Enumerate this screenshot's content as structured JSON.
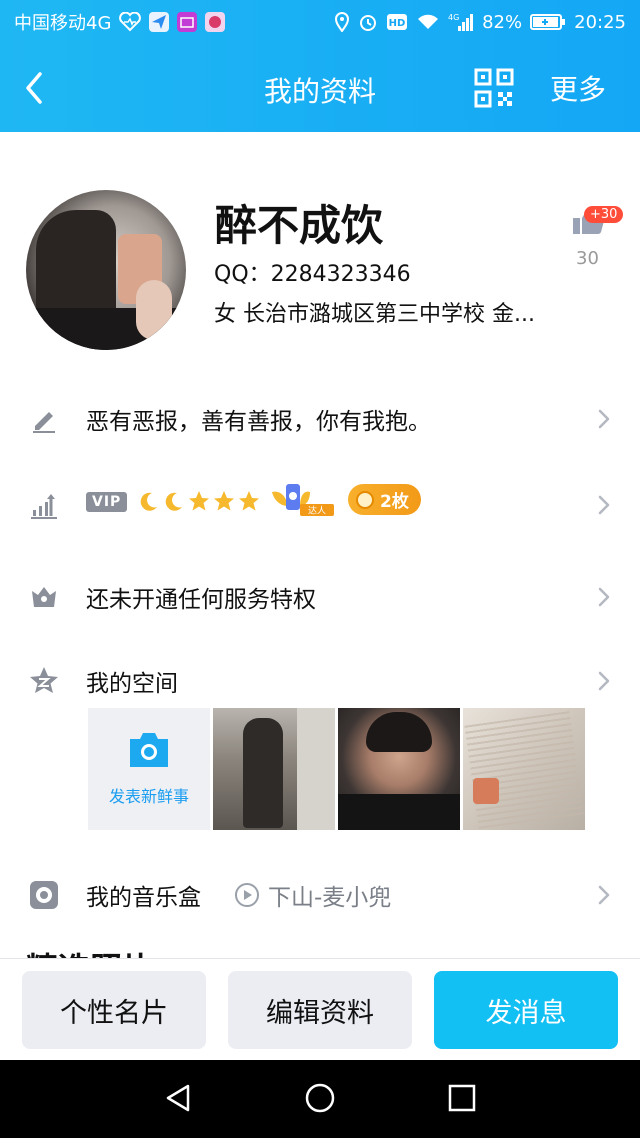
{
  "status_bar": {
    "carrier": "中国移动4G",
    "battery": "82%",
    "time": "20:25",
    "icons": [
      "heart-rate-icon",
      "send-app-icon",
      "mail-app-icon",
      "game-app-icon",
      "location-icon",
      "alarm-icon",
      "hd-icon",
      "wifi-icon",
      "signal-icon",
      "battery-icon"
    ]
  },
  "nav": {
    "title": "我的资料",
    "more": "更多"
  },
  "profile": {
    "name": "醉不成饮",
    "qq": "QQ：2284323346",
    "info": "女  长治市潞城区第三中学校  金...",
    "like_badge": "+30",
    "like_count": "30"
  },
  "rows": {
    "signature": "恶有恶报，善有善报，你有我抱。",
    "vip_label": "VIP",
    "coin_label": "2枚",
    "dr_label": "达人",
    "service": "还未开通任何服务特权",
    "space": "我的空间",
    "post_label": "发表新鲜事",
    "music": "我的音乐盒",
    "song": "下山-麦小兜"
  },
  "section_peek": "精选照片",
  "bottom": {
    "card": "个性名片",
    "edit": "编辑资料",
    "message": "发消息"
  },
  "colors": {
    "accent": "#12c0f4",
    "header": "#1fb7f3",
    "gray_button": "#ebedf3",
    "coin": "#f5a623",
    "badge_red": "#ff4d3a"
  }
}
